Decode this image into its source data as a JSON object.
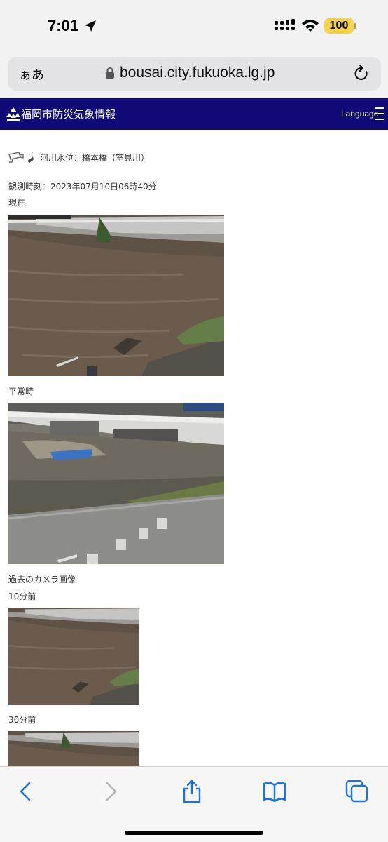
{
  "status": {
    "time": "7:01",
    "battery": "100"
  },
  "browser": {
    "aa_label": "ぁあ",
    "url": "bousai.city.fukuoka.lg.jp"
  },
  "site": {
    "title": "福岡市防災気象情報",
    "language_label": "Language"
  },
  "page": {
    "title": "河川水位：橋本橋（室見川）",
    "observation_time": "観測時刻：2023年07月10日06時40分",
    "current_label": "現在",
    "normal_label": "平常時",
    "past_images_label": "過去のカメラ画像",
    "ten_min_label": "10分前",
    "thirty_min_label": "30分前"
  },
  "icons": {
    "status": [
      "location-arrow-icon",
      "cellular-signal-icon",
      "wifi-icon",
      "battery-icon"
    ],
    "browser": [
      "lock-icon",
      "reload-icon"
    ],
    "site": [
      "city-logo-icon",
      "hamburger-menu-icon"
    ],
    "page": [
      "camera-icon",
      "river-icon"
    ],
    "toolbar": [
      "back-icon",
      "forward-icon",
      "share-icon",
      "bookmarks-icon",
      "tabs-icon"
    ]
  },
  "colors": {
    "header_bg": "#0f0a75",
    "toolbar_icon": "#1a73e8",
    "battery": "#f5d24a"
  }
}
